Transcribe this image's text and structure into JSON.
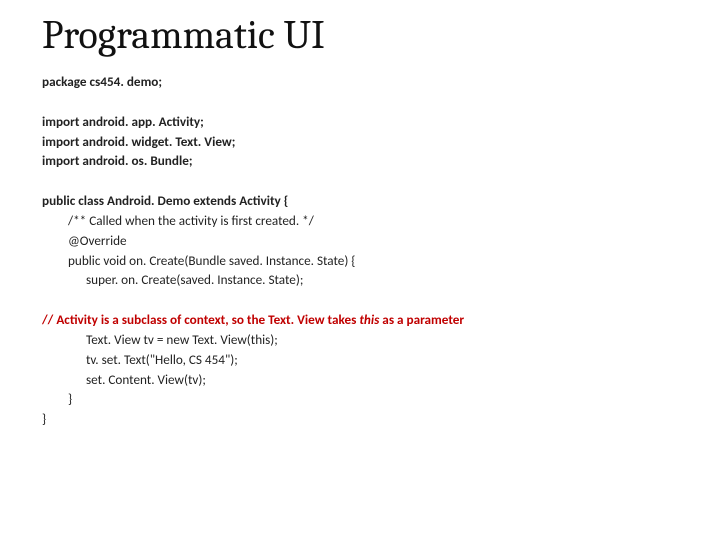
{
  "title": "Programmatic UI",
  "lines": {
    "l1": "package cs454. demo;",
    "l2": "import android. app. Activity;",
    "l3": "import android. widget. Text. View;",
    "l4": "import android. os. Bundle;",
    "l5": "public class Android. Demo extends Activity {",
    "l6": "/** Called when the activity is first created.  */",
    "l7": "@Override",
    "l8": "public void on. Create(Bundle saved. Instance. State) {",
    "l9": "super. on. Create(saved. Instance. State);",
    "c1a": "// Activity is a subclass of context, so the Text. View takes ",
    "c1b": "this",
    "c1c": " as a parameter",
    "l10": "Text. View tv = new Text. View(this);",
    "l11": "tv. set. Text(\"Hello, CS 454\");",
    "l12": "set. Content. View(tv);",
    "l13": "}",
    "l14": "}"
  }
}
